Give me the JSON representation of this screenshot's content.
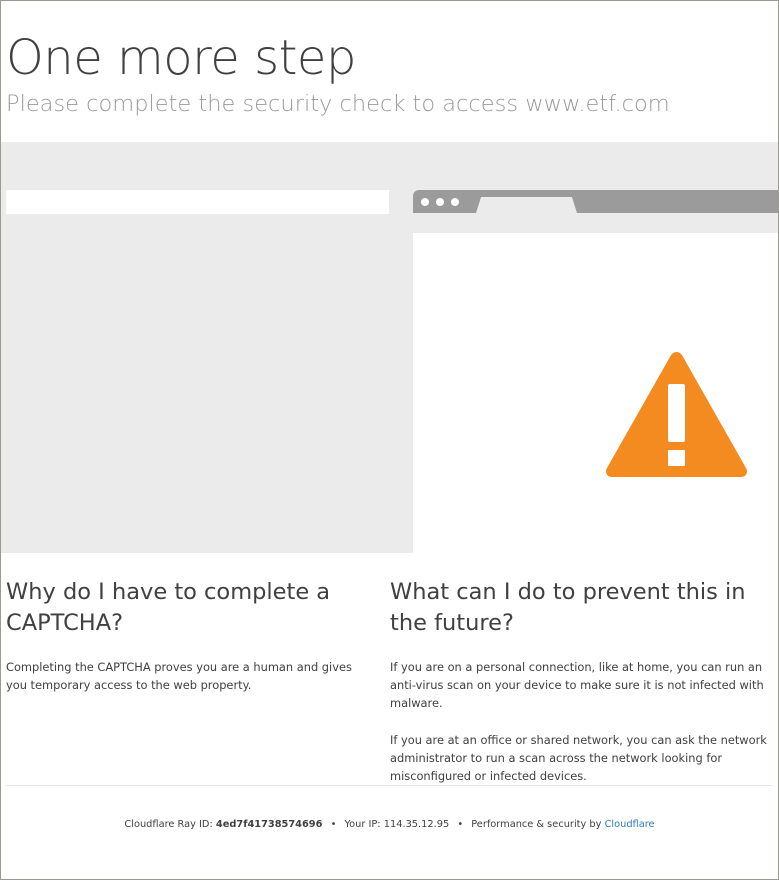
{
  "header": {
    "title": "One more step",
    "subtitle": "Please complete the security check to access www.etf.com"
  },
  "left": {
    "heading": "Why do I have to complete a CAPTCHA?",
    "body": "Completing the CAPTCHA proves you are a human and gives you temporary access to the web property."
  },
  "right": {
    "heading": "What can I do to prevent this in the future?",
    "para1": "If you are on a personal connection, like at home, you can run an anti-virus scan on your device to make sure it is not infected with malware.",
    "para2": "If you are at an office or shared network, you can ask the network administrator to run a scan across the network looking for misconfigured or infected devices."
  },
  "footer": {
    "ray_label": "Cloudflare Ray ID:",
    "ray_id": "4ed7f41738574696",
    "ip_label": "Your IP:",
    "ip": "114.35.12.95",
    "perf_label": "Performance & security by",
    "cloudflare_link": "Cloudflare",
    "bullet": "•"
  },
  "icons": {
    "warning": "warning-triangle-icon"
  },
  "colors": {
    "warning": "#f38b20",
    "link": "#2f7bbf",
    "band": "#ebebeb",
    "browser_bar": "#9b9b9b"
  }
}
